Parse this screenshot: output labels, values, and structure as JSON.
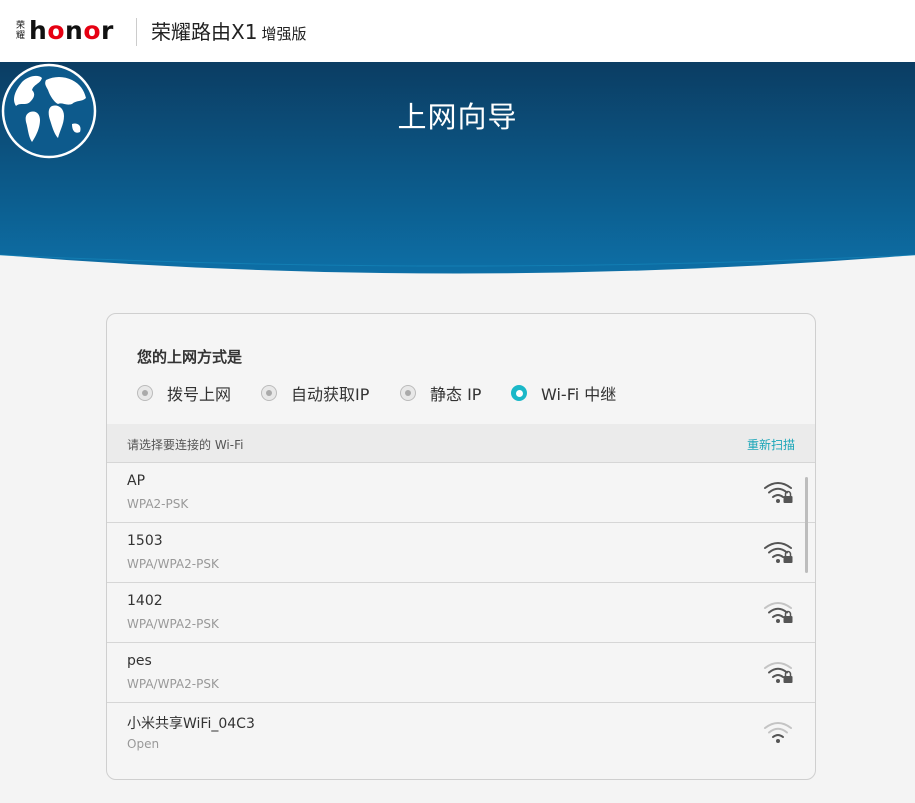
{
  "header": {
    "brand_cn_1": "荣",
    "brand_cn_2": "耀",
    "brand_logo": "honor",
    "product_name": "荣耀路由X1",
    "product_edition": "增强版"
  },
  "hero": {
    "title": "上网向导",
    "icon": "globe-icon",
    "gradient_top": "#0b3d63",
    "gradient_bottom": "#0d6fa6"
  },
  "connection": {
    "question": "您的上网方式是",
    "options": [
      {
        "label": "拨号上网",
        "selected": false
      },
      {
        "label": "自动获取IP",
        "selected": false
      },
      {
        "label": "静态 IP",
        "selected": false
      },
      {
        "label": "Wi-Fi 中继",
        "selected": true
      }
    ],
    "accent": "#1bb8c8"
  },
  "wifi": {
    "prompt": "请选择要连接的 Wi-Fi",
    "rescan": "重新扫描",
    "networks": [
      {
        "ssid": "AP",
        "security": "WPA2-PSK",
        "signal": "strong",
        "locked": true
      },
      {
        "ssid": "1503",
        "security": "WPA/WPA2-PSK",
        "signal": "strong",
        "locked": true
      },
      {
        "ssid": "1402",
        "security": "WPA/WPA2-PSK",
        "signal": "medium",
        "locked": true
      },
      {
        "ssid": "pes",
        "security": "WPA/WPA2-PSK",
        "signal": "medium",
        "locked": true
      },
      {
        "ssid": "小米共享WiFi_04C3",
        "security": "Open",
        "signal": "weak",
        "locked": false
      }
    ]
  }
}
